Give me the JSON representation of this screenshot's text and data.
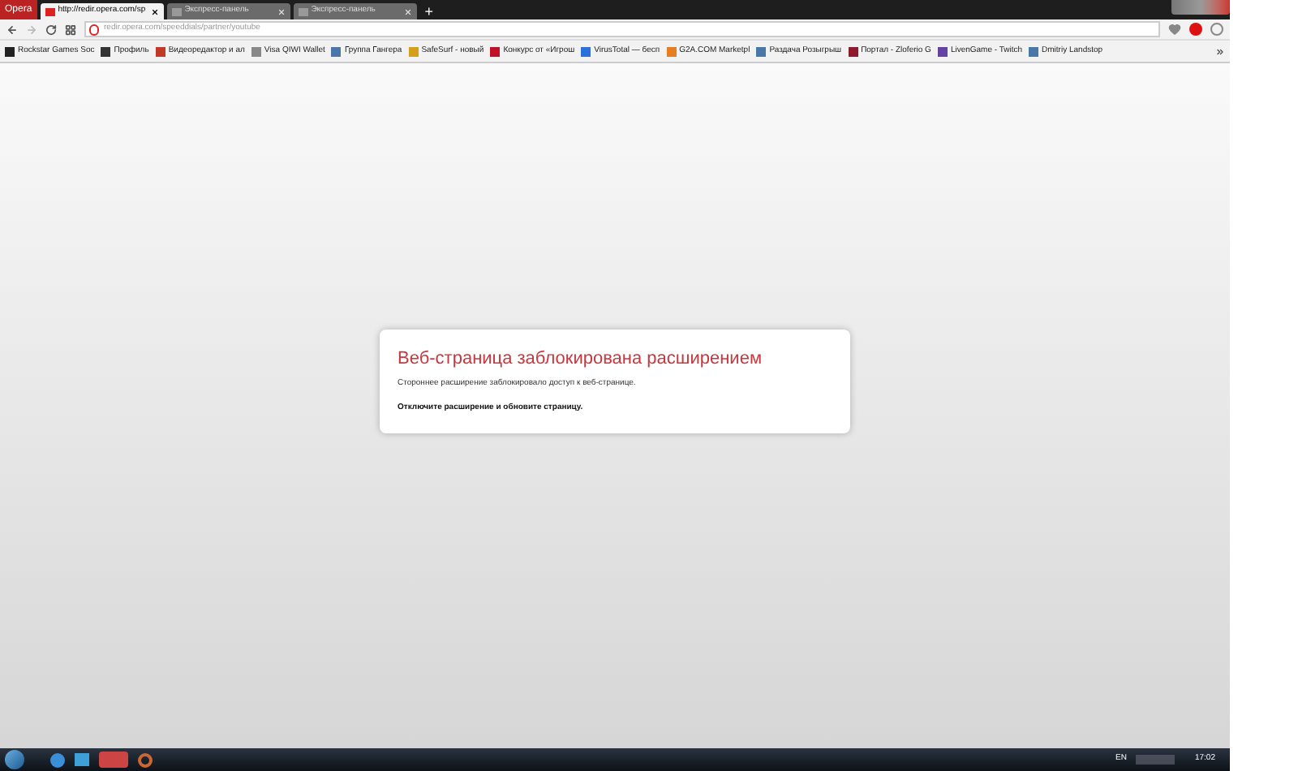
{
  "menu_button": {
    "label": "Opera"
  },
  "tabs": [
    {
      "label": "http://redir.opera.com/sp",
      "selected": true
    },
    {
      "label": "Экспресс-панель",
      "selected": false
    },
    {
      "label": "Экспресс-панель",
      "selected": false
    }
  ],
  "new_tab": "+",
  "address_bar": {
    "value": "redir.opera.com/speeddials/partner/youtube"
  },
  "bookmarks": [
    {
      "label": "Rockstar Games Soc",
      "color": "#222222"
    },
    {
      "label": "Профиль",
      "color": "#333333"
    },
    {
      "label": "Видеоредактор и ал",
      "color": "#c0392b"
    },
    {
      "label": "Visa QIWI Wallet",
      "color": "#888888"
    },
    {
      "label": "Группа Гангера",
      "color": "#4a76a8"
    },
    {
      "label": "SafeSurf - новый",
      "color": "#d4a017"
    },
    {
      "label": "Конкурс от «Игрош",
      "color": "#c0102a"
    },
    {
      "label": "VirusTotal — бесп",
      "color": "#2a6fdb"
    },
    {
      "label": "G2A.COM Marketpl",
      "color": "#e67e22"
    },
    {
      "label": "Раздача Розыгрыш",
      "color": "#4a76a8"
    },
    {
      "label": "Портал - Zloferio G",
      "color": "#8e1b2b"
    },
    {
      "label": "LivenGame - Twitch",
      "color": "#6441a5"
    },
    {
      "label": "Dmitriy Landstop",
      "color": "#4a76a8"
    }
  ],
  "error_card": {
    "title": "Веб-страница заблокирована расширением",
    "message": "Стороннее расширение заблокировало доступ к веб-странице.",
    "instruction": "Отключите расширение и обновите страницу."
  },
  "taskbar": {
    "language": "EN",
    "time": "17:02"
  }
}
